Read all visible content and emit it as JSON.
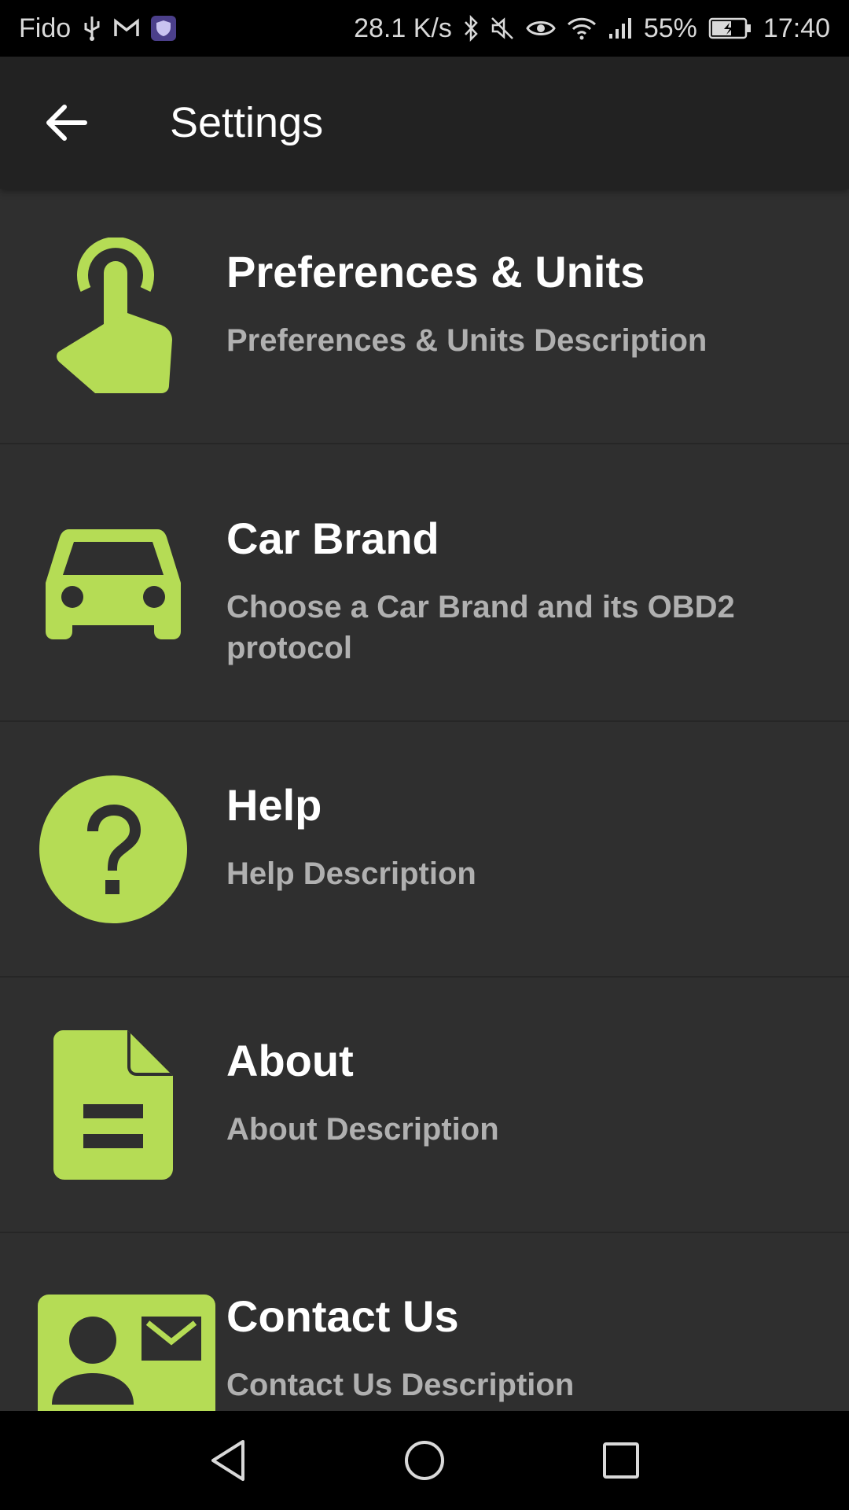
{
  "status_bar": {
    "carrier": "Fido",
    "net_speed": "28.1 K/s",
    "battery": "55%",
    "time": "17:40",
    "icons": [
      "usb-icon",
      "mail-icon",
      "vpn-shield-icon",
      "bluetooth-icon",
      "mute-icon",
      "eye-icon",
      "wifi-icon",
      "signal-icon",
      "battery-charging-icon"
    ]
  },
  "app_bar": {
    "title": "Settings",
    "back_icon": "arrow-back-icon"
  },
  "colors": {
    "accent": "#b5dc55",
    "background": "#2f2f2f",
    "app_bar": "#222222",
    "title_text": "#ffffff",
    "desc_text": "#b0b0b0"
  },
  "settings": {
    "items": [
      {
        "title": "Preferences & Units",
        "description": "Preferences & Units Description",
        "icon": "touch-hand-icon"
      },
      {
        "title": "Car Brand",
        "description": "Choose a Car Brand and its OBD2 protocol",
        "icon": "car-icon"
      },
      {
        "title": "Help",
        "description": "Help Description",
        "icon": "help-circle-icon"
      },
      {
        "title": "About",
        "description": "About Description",
        "icon": "document-icon"
      },
      {
        "title": "Contact Us",
        "description": "Contact Us Description",
        "icon": "contact-card-icon"
      }
    ]
  },
  "nav_bar": {
    "icons": [
      "nav-back-icon",
      "nav-home-icon",
      "nav-recents-icon"
    ]
  }
}
